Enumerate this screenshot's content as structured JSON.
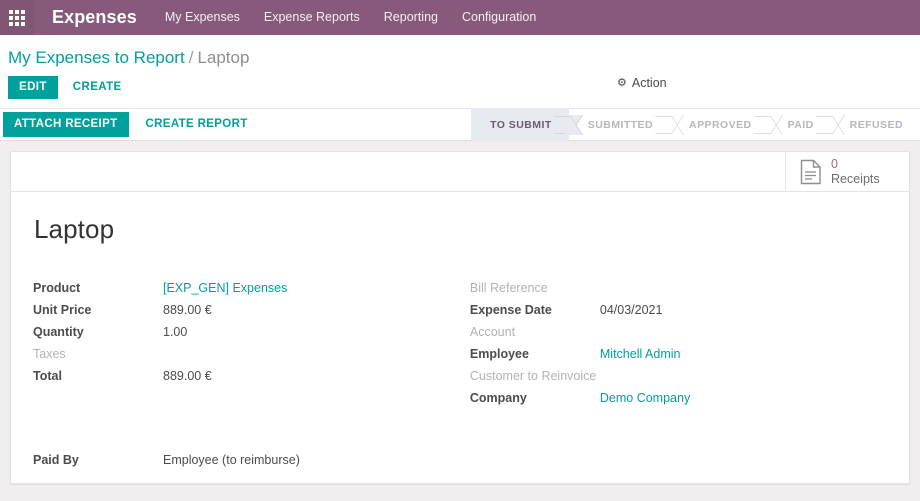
{
  "navbar": {
    "apps_icon": "apps-grid-icon",
    "brand": "Expenses",
    "menu": [
      {
        "label": "My Expenses"
      },
      {
        "label": "Expense Reports"
      },
      {
        "label": "Reporting"
      },
      {
        "label": "Configuration"
      }
    ]
  },
  "control_panel": {
    "breadcrumb": {
      "parent": "My Expenses to Report",
      "separator": "/",
      "current": "Laptop"
    },
    "edit_label": "EDIT",
    "create_label": "CREATE",
    "action_label": "Action",
    "action_icon": "gear-icon"
  },
  "statusbar": {
    "attach_receipt_label": "ATTACH RECEIPT",
    "create_report_label": "CREATE REPORT",
    "stages": [
      {
        "label": "TO SUBMIT",
        "active": true
      },
      {
        "label": "SUBMITTED",
        "active": false
      },
      {
        "label": "APPROVED",
        "active": false
      },
      {
        "label": "PAID",
        "active": false
      },
      {
        "label": "REFUSED",
        "active": false
      }
    ]
  },
  "sheet": {
    "stat_button": {
      "icon": "document-icon",
      "value": "0",
      "label": "Receipts"
    },
    "title": "Laptop",
    "left_fields": [
      {
        "label": "Product",
        "value": "[EXP_GEN] Expenses",
        "link": true,
        "empty": false
      },
      {
        "label": "Unit Price",
        "value": "889.00 €",
        "link": false,
        "empty": false
      },
      {
        "label": "Quantity",
        "value": "1.00",
        "link": false,
        "empty": false
      },
      {
        "label": "Taxes",
        "value": "",
        "link": false,
        "empty": true
      },
      {
        "label": "Total",
        "value": "889.00 €",
        "link": false,
        "empty": false
      }
    ],
    "right_fields": [
      {
        "label": "Bill Reference",
        "value": "",
        "link": false,
        "empty": true
      },
      {
        "label": "Expense Date",
        "value": "04/03/2021",
        "link": false,
        "empty": false
      },
      {
        "label": "Account",
        "value": "",
        "link": false,
        "empty": true
      },
      {
        "label": "Employee",
        "value": "Mitchell Admin",
        "link": true,
        "empty": false
      },
      {
        "label": "Customer to Reinvoice",
        "value": "",
        "link": false,
        "empty": true
      },
      {
        "label": "Company",
        "value": "Demo Company",
        "link": true,
        "empty": false
      }
    ],
    "paid_by": {
      "label": "Paid By",
      "value": "Employee (to reimburse)"
    }
  },
  "colors": {
    "brand_purple": "#875a7b",
    "accent_teal": "#00a09d",
    "stage_active_bg": "#e7eaee",
    "stat_value": "#9b6d8b"
  }
}
